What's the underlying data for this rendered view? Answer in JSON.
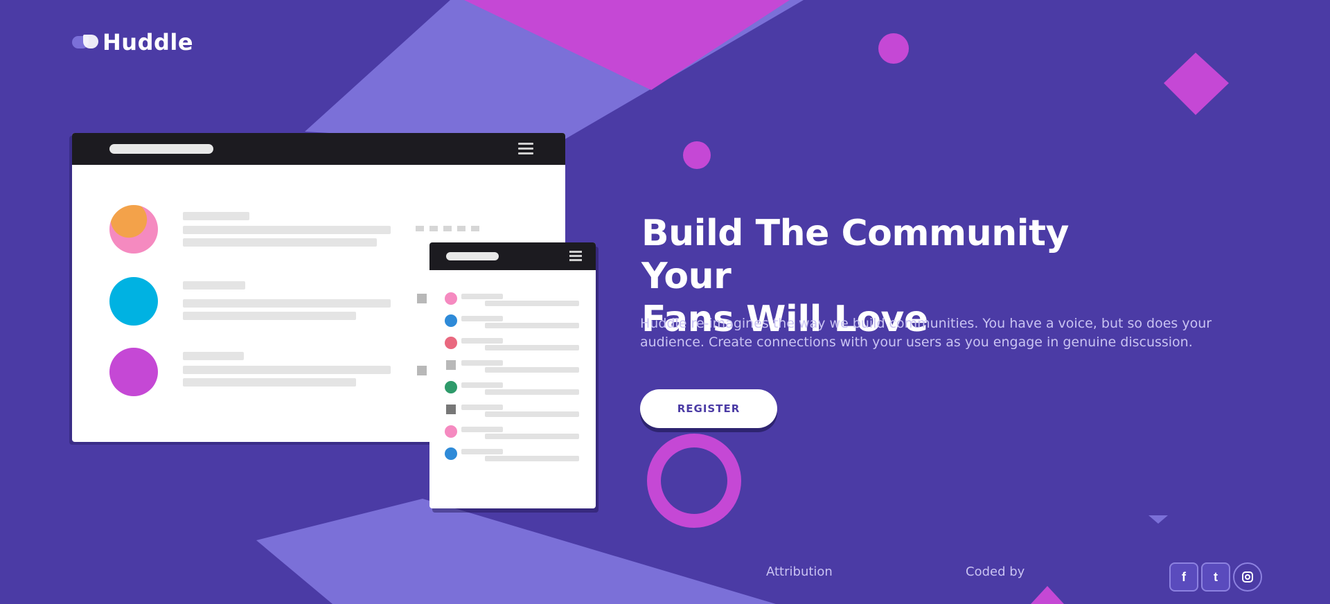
{
  "brand": {
    "name": "Huddle"
  },
  "hero": {
    "title_line1": "Build The Community Your",
    "title_line2": "Fans Will Love",
    "description": "Huddle re-imagines the way we build communities. You have a voice, but so does your audience. Create connections with your users as you engage in genuine discussion.",
    "cta_label": "REGISTER"
  },
  "footer": {
    "links": [
      "Attribution",
      "Coded by"
    ],
    "social_icons": [
      "facebook-icon",
      "twitter-icon",
      "instagram-icon"
    ]
  },
  "colors": {
    "background": "#4b3ba5",
    "accent_violet": "#7b70d8",
    "accent_magenta": "#c548d5",
    "avatar_pink": "#f58ac0",
    "avatar_blue": "#00b2e2",
    "avatar_purple": "#c548d5"
  }
}
